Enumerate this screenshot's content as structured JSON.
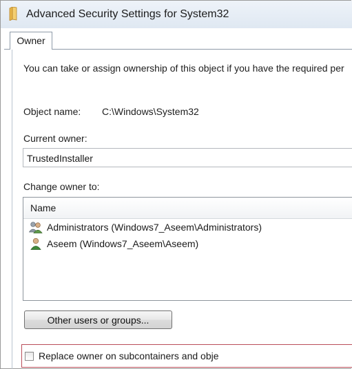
{
  "window": {
    "title": "Advanced Security Settings for System32"
  },
  "tabs": [
    {
      "label": "Owner",
      "selected": true
    }
  ],
  "owner_tab": {
    "info_text": "You can take or assign ownership of this object if you have the required per",
    "object_name_label": "Object name:",
    "object_name_value": "C:\\Windows\\System32",
    "current_owner_label": "Current owner:",
    "current_owner_value": "TrustedInstaller",
    "change_owner_label": "Change owner to:",
    "list": {
      "column_header": "Name",
      "items": [
        {
          "label": "Administrators (Windows7_Aseem\\Administrators)",
          "icon": "users-group-icon"
        },
        {
          "label": "Aseem (Windows7_Aseem\\Aseem)",
          "icon": "user-icon"
        }
      ]
    },
    "other_users_button": "Other users or groups...",
    "replace_owner_checkbox": {
      "label": "Replace owner on subcontainers and obje",
      "checked": false
    }
  },
  "colors": {
    "highlight_border": "#b94c58",
    "titlebar": "#dfe8f2"
  }
}
